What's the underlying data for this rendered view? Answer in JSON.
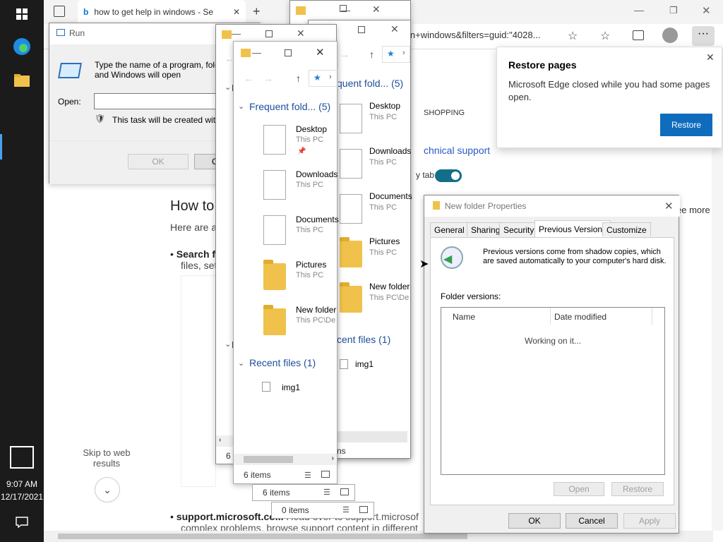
{
  "taskbar": {
    "time": "9:07 AM",
    "date": "12/17/2021",
    "colors": {
      "bg": "#1b1b1b",
      "accent": "#0078d4"
    }
  },
  "edge": {
    "tab_title": "how to get help in windows - Se",
    "address": "in+windows&filters=guid:\"4028...",
    "page": {
      "shopping": "SHOPPING",
      "tech_support": "chnical support",
      "toggle_label": "y tab",
      "see_more": "ee more",
      "heading": "How to",
      "intro": "Here are a",
      "bullet1_bold": "Search f",
      "bullet1_rest": "files, set",
      "skip": "Skip to web results",
      "bullet2_bold": "support.microsoft.co...",
      "bullet2_rest": "Head over to support.microsof",
      "bullet2_line2": "complex problems, browse support content in different"
    },
    "restore_popup": {
      "title": "Restore pages",
      "body": "Microsoft Edge closed while you had some pages open.",
      "button": "Restore"
    }
  },
  "run_dialog": {
    "title": "Run",
    "description": "Type the name of a program, fold resource, and Windows will open",
    "open_label": "Open:",
    "admin_note": "This task will be created with",
    "ok": "OK",
    "cancel": "C"
  },
  "explorer": {
    "frequent_short": "Frequent fold...",
    "frequent_short2": "quent fold...",
    "frequent_count": "(5)",
    "recent_label": "Recent files",
    "recent_short": "cent files",
    "recent_count": "(1)",
    "items": [
      {
        "name": "Desktop",
        "sub": "This PC"
      },
      {
        "name": "Downloads",
        "sub": "This PC"
      },
      {
        "name": "Documents",
        "sub": "This PC"
      },
      {
        "name": "Pictures",
        "sub": "This PC"
      },
      {
        "name": "New folder",
        "sub": "This PC\\De"
      }
    ],
    "items_b_sub_newfolder": "This PC\\De",
    "recent_file": "img1",
    "status_6": "6 items",
    "status_6b": "6 i",
    "status_0": "0 items",
    "status_ns": "ns",
    "f_letter": "F"
  },
  "properties": {
    "title": "New folder Properties",
    "tabs": [
      "General",
      "Sharing",
      "Security",
      "Previous Versions",
      "Customize"
    ],
    "active_tab": "Previous Versions",
    "info": "Previous versions come from shadow copies, which are saved automatically to your computer's hard disk.",
    "folder_versions": "Folder versions:",
    "col_name": "Name",
    "col_date": "Date modified",
    "working": "Working on it...",
    "open": "Open",
    "restore": "Restore",
    "ok": "OK",
    "cancel": "Cancel",
    "apply": "Apply"
  }
}
